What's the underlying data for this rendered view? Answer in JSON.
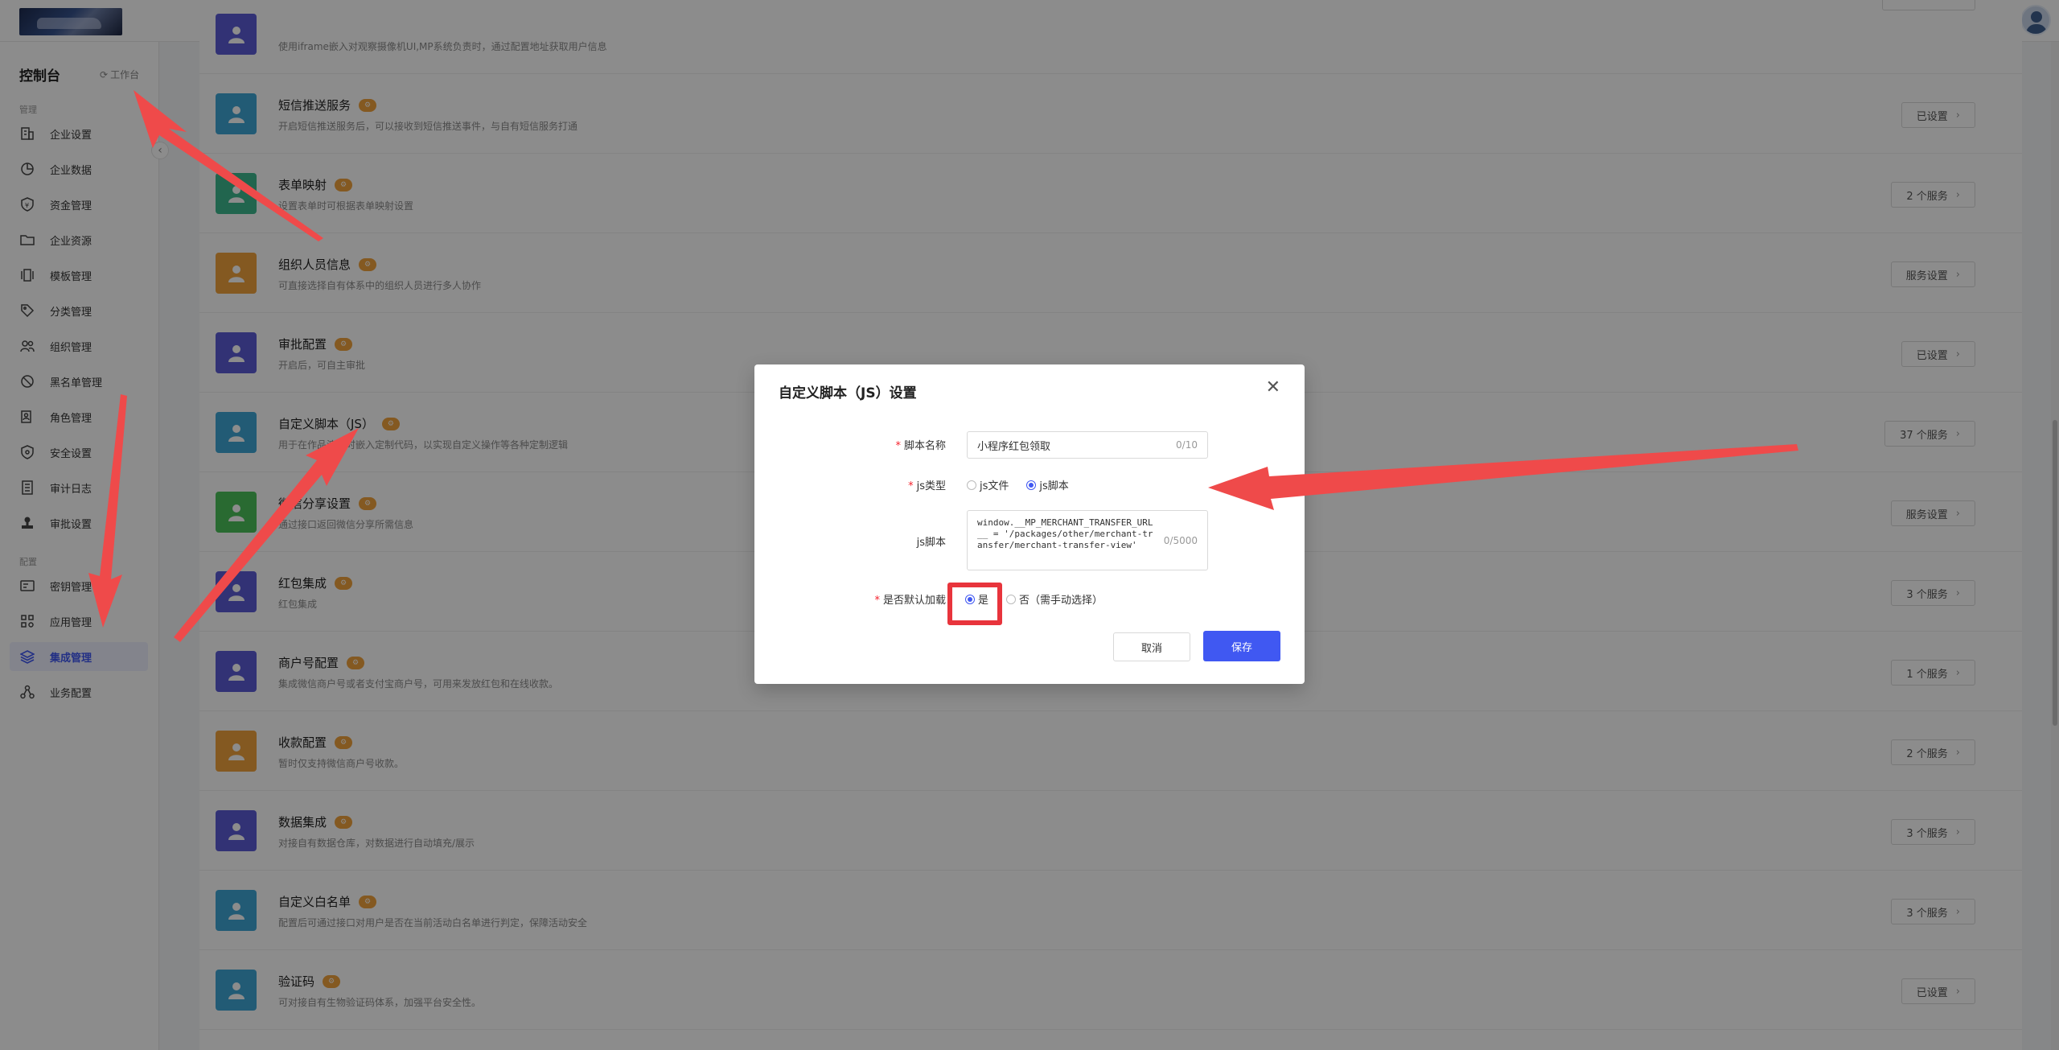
{
  "sidebar": {
    "title": "控制台",
    "workspace_label": "工作台",
    "group_manage": "管理",
    "group_config": "配置",
    "items": [
      {
        "label": "企业设置",
        "icon": "building-icon"
      },
      {
        "label": "企业数据",
        "icon": "pie-chart-icon"
      },
      {
        "label": "资金管理",
        "icon": "shield-money-icon"
      },
      {
        "label": "企业资源",
        "icon": "folder-icon"
      },
      {
        "label": "模板管理",
        "icon": "template-icon"
      },
      {
        "label": "分类管理",
        "icon": "tag-icon"
      },
      {
        "label": "组织管理",
        "icon": "people-icon"
      },
      {
        "label": "黑名单管理",
        "icon": "block-icon"
      },
      {
        "label": "角色管理",
        "icon": "role-icon"
      },
      {
        "label": "安全设置",
        "icon": "security-icon"
      },
      {
        "label": "审计日志",
        "icon": "log-icon"
      },
      {
        "label": "审批设置",
        "icon": "stamp-icon"
      },
      {
        "label": "密钥管理",
        "icon": "key-card-icon"
      },
      {
        "label": "应用管理",
        "icon": "apps-icon"
      },
      {
        "label": "集成管理",
        "icon": "layers-icon",
        "active": true
      },
      {
        "label": "业务配置",
        "icon": "nodes-icon"
      }
    ]
  },
  "list": {
    "rows": [
      {
        "title": "",
        "desc": "使用iframe嵌入对观察摄像机UI,MP系统负责时，通过配置地址获取用户信息",
        "button": "",
        "color": "#5b5bd6"
      },
      {
        "title": "短信推送服务",
        "desc": "开启短信推送服务后，可以接收到短信推送事件，与自有短信服务打通",
        "button": "已设置",
        "color": "#3fa7d6"
      },
      {
        "title": "表单映射",
        "desc": "设置表单时可根据表单映射设置",
        "button": "2 个服务",
        "color": "#3cb98f"
      },
      {
        "title": "组织人员信息",
        "desc": "可直接选择自有体系中的组织人员进行多人协作",
        "button": "服务设置",
        "color": "#f0a23c"
      },
      {
        "title": "审批配置",
        "desc": "开启后，可自主审批",
        "button": "已设置",
        "color": "#5b5bd6"
      },
      {
        "title": "自定义脚本（JS）",
        "desc": "用于在作品渲染时嵌入定制代码，以实现自定义操作等各种定制逻辑",
        "button": "37 个服务",
        "color": "#3fa7d6"
      },
      {
        "title": "微信分享设置",
        "desc": "通过接口返回微信分享所需信息",
        "button": "服务设置",
        "color": "#4cc15a"
      },
      {
        "title": "红包集成",
        "desc": "红包集成",
        "button": "3 个服务",
        "color": "#5b5bd6"
      },
      {
        "title": "商户号配置",
        "desc": "集成微信商户号或者支付宝商户号，可用来发放红包和在线收款。",
        "button": "1 个服务",
        "color": "#5b5bd6"
      },
      {
        "title": "收款配置",
        "desc": "暂时仅支持微信商户号收款。",
        "button": "2 个服务",
        "color": "#f0a23c"
      },
      {
        "title": "数据集成",
        "desc": "对接自有数据仓库，对数据进行自动填充/展示",
        "button": "3 个服务",
        "color": "#5b5bd6"
      },
      {
        "title": "自定义白名单",
        "desc": "配置后可通过接口对用户是否在当前活动白名单进行判定，保障活动安全",
        "button": "3 个服务",
        "color": "#3fa7d6"
      },
      {
        "title": "验证码",
        "desc": "可对接自有生物验证码体系，加强平台安全性。",
        "button": "已设置",
        "color": "#3fa7d6"
      }
    ]
  },
  "modal": {
    "title": "自定义脚本（JS）设置",
    "fields": {
      "name_label": "脚本名称",
      "name_value": "小程序红包领取",
      "name_count": "0/10",
      "type_label": "js类型",
      "type_option_file": "js文件",
      "type_option_script": "js脚本",
      "type_selected": "js脚本",
      "script_label": "js脚本",
      "script_value": "window.__MP_MERCHANT_TRANSFER_URL__ = '/packages/other/merchant-transfer/merchant-transfer-view'",
      "script_count": "0/5000",
      "default_label": "是否默认加载",
      "default_yes": "是",
      "default_no": "否（需手动选择）",
      "default_selected": "是"
    },
    "cancel_label": "取消",
    "save_label": "保存"
  },
  "colors": {
    "primary": "#4058f2",
    "annotation_red": "#e8343c"
  }
}
